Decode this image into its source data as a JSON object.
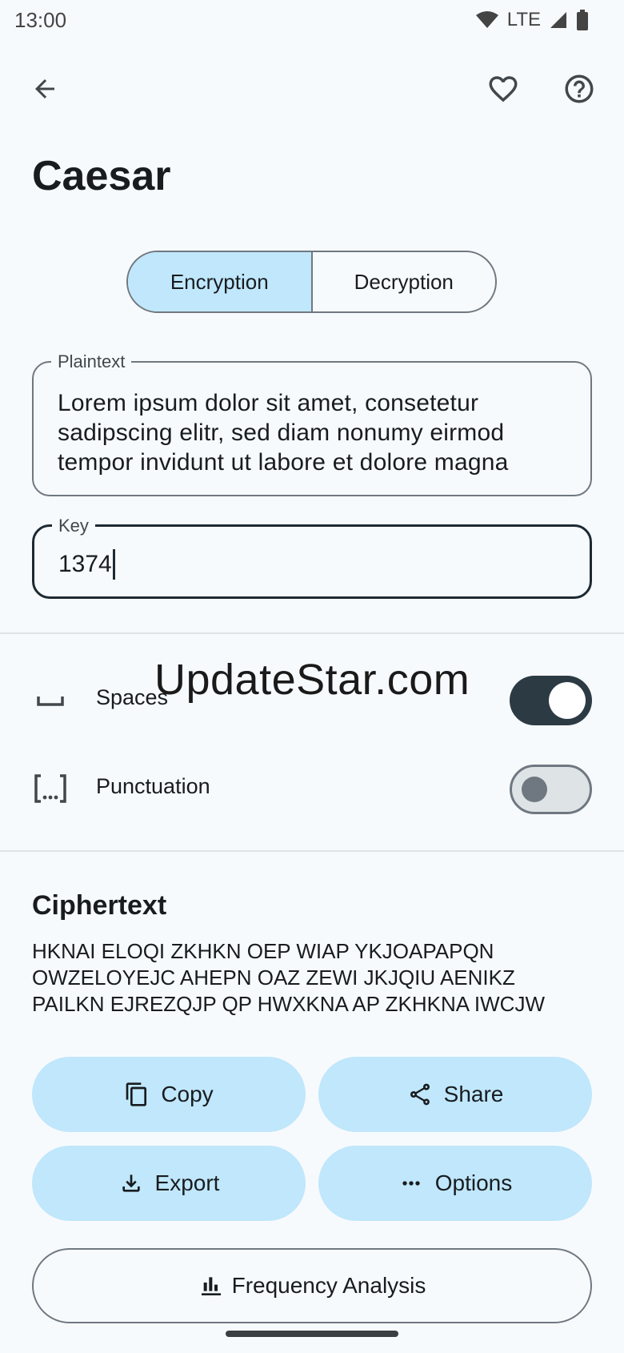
{
  "status_bar": {
    "time": "13:00",
    "network": "LTE"
  },
  "header": {
    "back_icon": "arrow-left-icon",
    "favorite_icon": "heart-outline-icon",
    "help_icon": "help-circle-icon"
  },
  "page": {
    "title": "Caesar"
  },
  "mode_selector": {
    "options": [
      "Encryption",
      "Decryption"
    ],
    "selected": "Encryption"
  },
  "plaintext_field": {
    "label": "Plaintext",
    "lines": [
      "Lorem ipsum dolor sit amet, consetetur",
      "sadipscing elitr, sed diam nonumy eirmod",
      "tempor invidunt ut labore et dolore magna"
    ]
  },
  "key_field": {
    "label": "Key",
    "value": "1374"
  },
  "options": [
    {
      "label": "Spaces",
      "icon": "space-bar-icon",
      "enabled": true
    },
    {
      "label": "Punctuation",
      "icon": "bracket-ellipsis-icon",
      "enabled": false
    }
  ],
  "watermark": "UpdateStar.com",
  "ciphertext": {
    "title": "Ciphertext",
    "lines": [
      "HKNAI ELOQI ZKHKN OEP WIAP YKJOAPAPQN",
      "OWZELOYEJC AHEPN OAZ ZEWI JKJQIU AENIKZ",
      "PAILKN EJREZQJP QP HWXKNA AP ZKHKNA IWCJW"
    ]
  },
  "actions": {
    "copy": "Copy",
    "share": "Share",
    "export": "Export",
    "options": "Options",
    "frequency_analysis": "Frequency Analysis"
  },
  "colors": {
    "accent_container": "#c0e7fb",
    "background": "#f7fafd",
    "switch_on": "#2c3a43",
    "outline": "#6f7880"
  }
}
